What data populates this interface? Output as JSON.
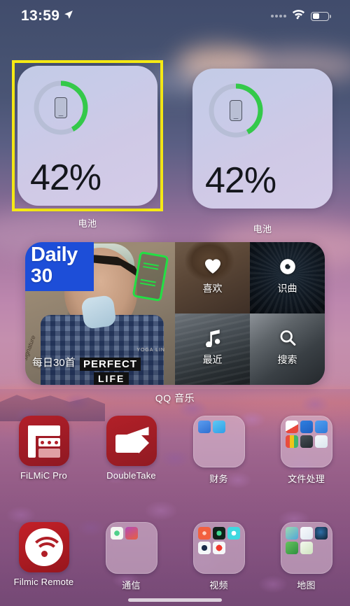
{
  "status_bar": {
    "time": "13:59",
    "location_icon": "location-arrow-icon",
    "signal_icon": "signal-dots-icon",
    "wifi_icon": "wifi-icon",
    "battery_icon": "battery-icon",
    "battery_level_percent": 45
  },
  "widgets": {
    "battery": [
      {
        "label": "电池",
        "percent_text": "42%",
        "percent_value": 42,
        "device_icon": "iphone-icon",
        "ring_color": "#34c94a",
        "track_color": "#b7bed6",
        "selected": true
      },
      {
        "label": "电池",
        "percent_text": "42%",
        "percent_value": 42,
        "device_icon": "iphone-icon",
        "ring_color": "#34c94a",
        "track_color": "#b7bed6",
        "selected": false
      }
    ],
    "music": {
      "caption": "QQ 音乐",
      "left_panel": {
        "badge_title": "Daily",
        "badge_number": "30",
        "label": "每日30首",
        "artwork_text_1": "PERFECT",
        "artwork_text_2": "LIFE",
        "artwork_credit": "YOGA LIN"
      },
      "quadrants": [
        {
          "label": "喜欢",
          "icon": "heart-icon"
        },
        {
          "label": "识曲",
          "icon": "music-recognition-icon"
        },
        {
          "label": "最近",
          "icon": "music-note-icon"
        },
        {
          "label": "搜索",
          "icon": "search-icon"
        }
      ]
    }
  },
  "selection_color": "#f6ea14",
  "apps": {
    "rows": [
      [
        {
          "name": "FiLMiC Pro",
          "type": "app",
          "icon": "filmic-pro-icon",
          "color": "#b21f29"
        },
        {
          "name": "DoubleTake",
          "type": "app",
          "icon": "doubletake-icon",
          "color": "#b22028"
        },
        {
          "name": "财务",
          "type": "folder",
          "icon": "folder-icon",
          "mini_count": 2,
          "mini_colors": [
            "#3c82e0",
            "#2f9ee8",
            "",
            "",
            "",
            "",
            "",
            "",
            ""
          ]
        },
        {
          "name": "文件处理",
          "type": "folder",
          "icon": "folder-icon",
          "mini_count": 6,
          "mini_colors": [
            "#f2f2f2",
            "#1f6fd0",
            "#2f86e8",
            "#e8483c",
            "#2f3a40",
            "#f0f4f8",
            "",
            "",
            ""
          ]
        }
      ],
      [
        {
          "name": "Filmic Remote",
          "type": "app",
          "icon": "filmic-remote-icon",
          "color": "#c32028"
        },
        {
          "name": "通信",
          "type": "folder",
          "icon": "folder-icon",
          "mini_count": 2,
          "mini_colors": [
            "#f4f7f2",
            "#b34ab8",
            "",
            "",
            "",
            "",
            "",
            "",
            ""
          ]
        },
        {
          "name": "视频",
          "type": "folder",
          "icon": "folder-icon",
          "mini_count": 5,
          "mini_colors": [
            "#f2603f",
            "#10211a",
            "#3fd8e0",
            "#f4f6f8",
            "#f6f7f9",
            "",
            "",
            "",
            ""
          ]
        },
        {
          "name": "地图",
          "type": "folder",
          "icon": "folder-icon",
          "mini_count": 5,
          "mini_colors": [
            "#8cc9a8",
            "#f4f6f8",
            "#17304a",
            "#4cb050",
            "#f0f6ea",
            "",
            "",
            "",
            ""
          ]
        }
      ]
    ]
  }
}
